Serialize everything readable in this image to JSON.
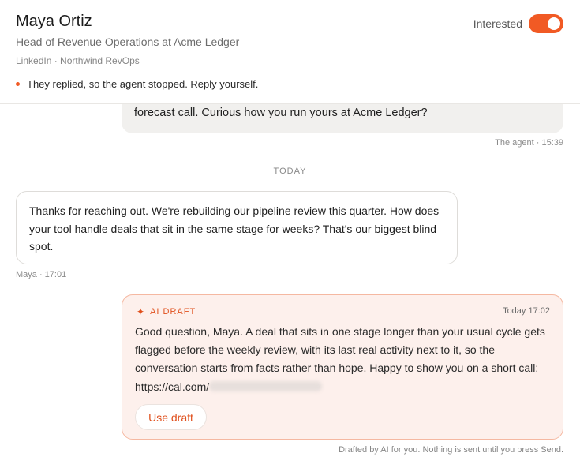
{
  "contact": {
    "name": "Maya Ortiz",
    "role": "Head of Revenue Operations at Acme Ledger",
    "source": "LinkedIn · Northwind RevOps",
    "notice": "They replied, so the agent stopped. Reply yourself."
  },
  "status": {
    "label": "Interested",
    "toggle_on": true,
    "accent_color": "#f15a24"
  },
  "thread": {
    "agent_message": {
      "text": "forecast call. Curious how you run yours at Acme Ledger?",
      "meta": "The agent · 15:39"
    },
    "divider": "TODAY",
    "lead_message": {
      "text": "Thanks for reaching out. We're rebuilding our pipeline review this quarter. How does your tool handle deals that sit in the same stage for weeks? That's our biggest blind spot.",
      "meta": "Maya · 17:01"
    }
  },
  "draft": {
    "icon": "sparkle-icon",
    "label": "AI DRAFT",
    "time": "Today 17:02",
    "text": "Good question, Maya. A deal that sits in one stage longer than your usual cycle gets flagged before the weekly review, with its last real activity next to it, so the conversation starts from facts rather than hope. Happy to show you on a short call: https://cal.com/",
    "use_button": "Use draft",
    "footnote": "Drafted by AI for you. Nothing is sent until you press Send."
  }
}
